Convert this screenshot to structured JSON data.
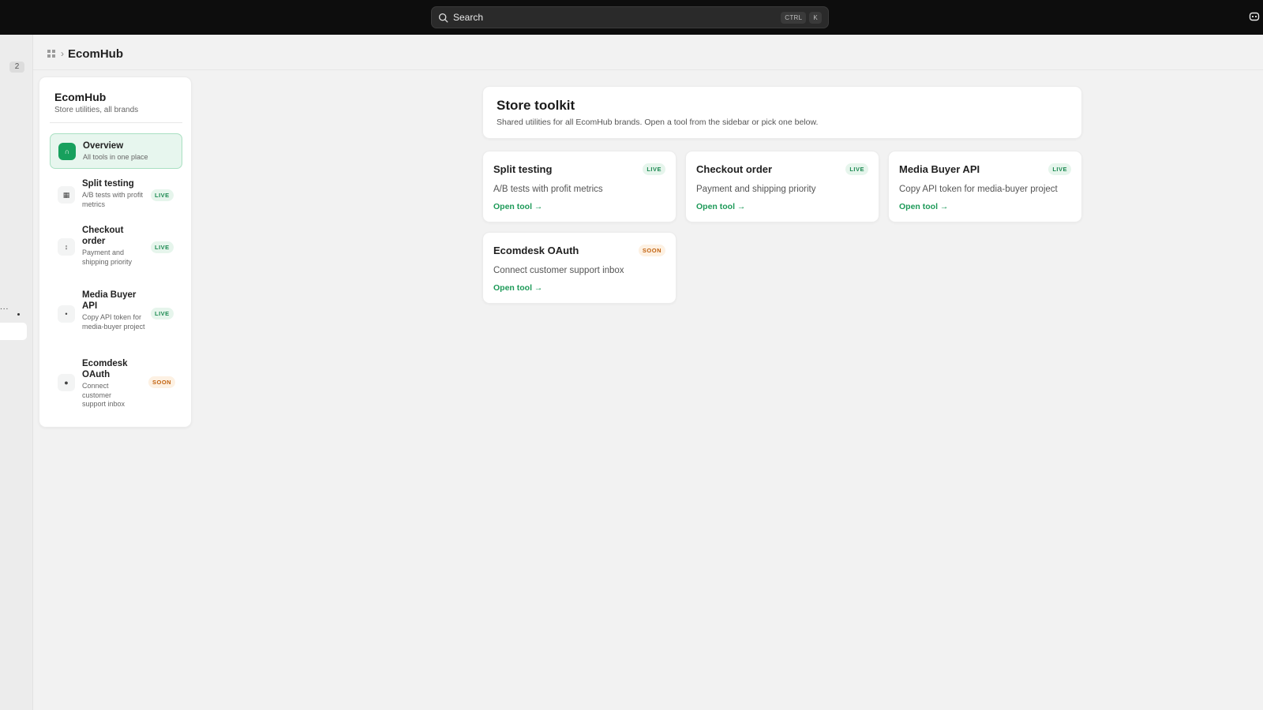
{
  "topbar": {
    "search_placeholder": "Search",
    "shortcut_ctrl": "CTRL",
    "shortcut_key": "K"
  },
  "rail": {
    "badge": "2",
    "dots": "..."
  },
  "breadcrumb": {
    "title": "EcomHub"
  },
  "sidebar": {
    "title": "EcomHub",
    "subtitle": "Store utilities, all brands",
    "items": [
      {
        "label": "Overview",
        "desc": "All tools in one place",
        "icon": "home-icon",
        "glyph": "∩",
        "status": ""
      },
      {
        "label": "Split testing",
        "desc": "A/B tests with profit metrics",
        "icon": "grid-icon",
        "glyph": "▦",
        "status": "LIVE"
      },
      {
        "label": "Checkout order",
        "desc": "Payment and shipping priority",
        "icon": "sort-icon",
        "glyph": "↕",
        "status": "LIVE"
      },
      {
        "label": "Media Buyer API",
        "desc": "Copy API token for media-buyer project",
        "icon": "dot-icon",
        "glyph": "•",
        "status": "LIVE"
      },
      {
        "label": "Ecomdesk OAuth",
        "desc": "Connect customer support inbox",
        "icon": "circle-icon",
        "glyph": "●",
        "status": "SOON"
      }
    ]
  },
  "main": {
    "title": "Store toolkit",
    "subtitle": "Shared utilities for all EcomHub brands. Open a tool from the sidebar or pick one below.",
    "open_label": "Open tool →",
    "tools": [
      {
        "title": "Split testing",
        "desc": "A/B tests with profit metrics",
        "status": "LIVE"
      },
      {
        "title": "Checkout order",
        "desc": "Payment and shipping priority",
        "status": "LIVE"
      },
      {
        "title": "Media Buyer API",
        "desc": "Copy API token for media-buyer project",
        "status": "LIVE"
      },
      {
        "title": "Ecomdesk OAuth",
        "desc": "Connect customer support inbox",
        "status": "SOON"
      }
    ]
  },
  "colors": {
    "accent": "#1d9a58",
    "live": "#1d8a52",
    "soon": "#c2620f",
    "topbar": "#0d0d0d"
  }
}
